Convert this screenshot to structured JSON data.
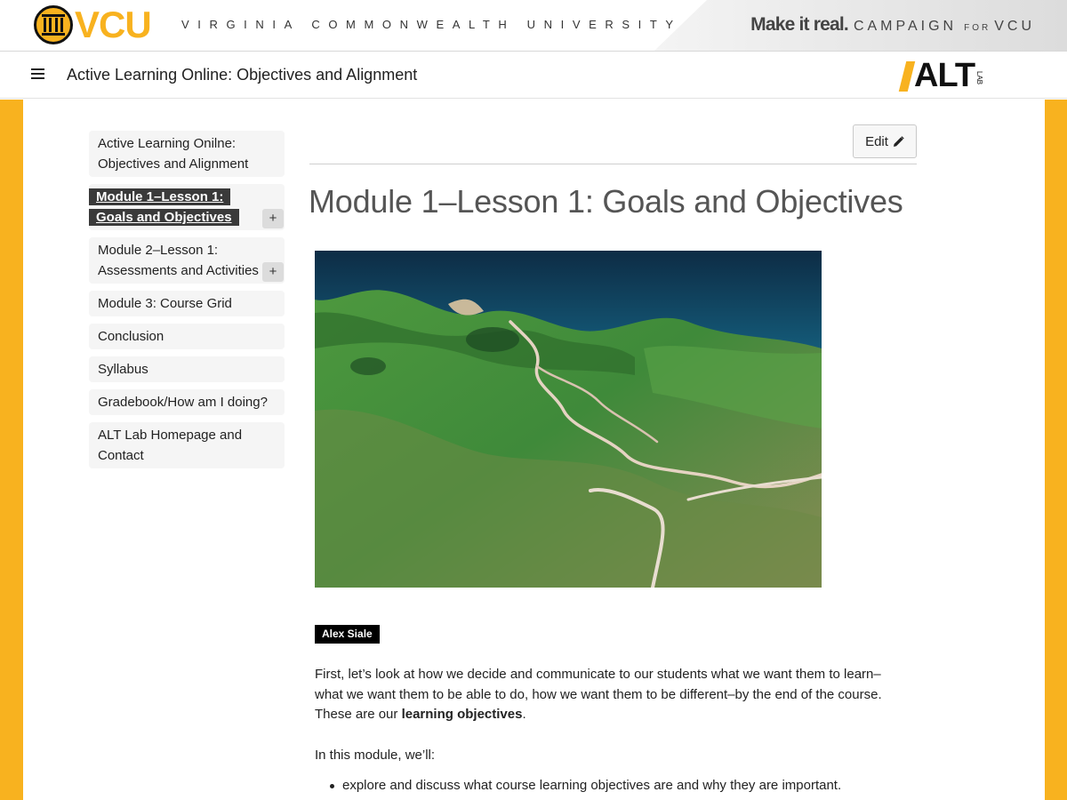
{
  "vcu_bar": {
    "wordmark": "VCU",
    "full_name": "VIRGINIA COMMONWEALTH UNIVERSITY",
    "campaign_strong": "Make it real.",
    "campaign_light": "CAMPAIGN",
    "campaign_for": "FOR",
    "campaign_vcu": "VCU"
  },
  "site_header": {
    "title": "Active Learning Online: Objectives and Alignment",
    "logo_text": "ALT",
    "logo_sub": "LAB"
  },
  "sidebar": {
    "items": [
      {
        "label": "Active Learning Onilne: Objectives and Alignment"
      },
      {
        "label": "Module 1–Lesson 1: Goals and Objectives",
        "active": true,
        "expand": "+"
      },
      {
        "label": "Module 2–Lesson 1: Assessments and Activities",
        "expand": "+"
      },
      {
        "label": "Module 3: Course Grid"
      },
      {
        "label": "Conclusion"
      },
      {
        "label": "Syllabus"
      },
      {
        "label": "Gradebook/How am I doing?"
      },
      {
        "label": "ALT Lab Homepage and Contact"
      }
    ]
  },
  "main": {
    "edit_label": "Edit",
    "page_title": "Module 1–Lesson 1: Goals and Objectives",
    "image_credit": "Alex Siale",
    "paragraph1_pre": "First, let’s look at how we decide and communicate to our students what we want them to learn–what we want them to be able to do, how we want them to be different–by the end of the course. These are our ",
    "paragraph1_bold": "learning objectives",
    "paragraph1_post": ".",
    "paragraph2": "In this module, we’ll:",
    "bullets": [
      "explore and discuss what course learning objectives are and why they are important."
    ]
  },
  "colors": {
    "vcu_gold": "#f8b21f",
    "active_nav_bg": "#3a3a3a",
    "title_gray": "#555555"
  }
}
